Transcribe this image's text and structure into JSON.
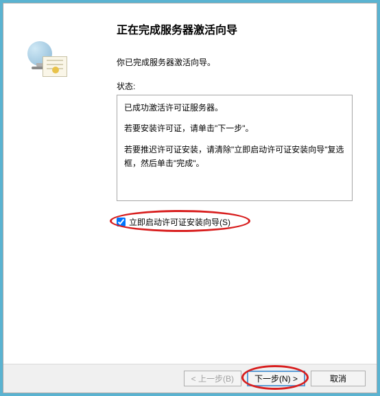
{
  "wizard": {
    "title": "正在完成服务器激活向导",
    "subtitle": "你已完成服务器激活向导。",
    "status_label": "状态:",
    "status_lines": {
      "line1": "已成功激活许可证服务器。",
      "line2": "若要安装许可证，请单击\"下一步\"。",
      "line3": "若要推迟许可证安装，请清除\"立即启动许可证安装向导\"复选框，然后单击\"完成\"。"
    },
    "checkbox": {
      "label": "立即启动许可证安装向导(S)",
      "checked": true
    }
  },
  "buttons": {
    "back": "< 上一步(B)",
    "next": "下一步(N) >",
    "cancel": "取消"
  }
}
